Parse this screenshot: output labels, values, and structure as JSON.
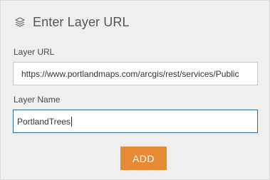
{
  "header": {
    "title": "Enter Layer URL",
    "icon": "layers-icon"
  },
  "layer_url": {
    "label": "Layer URL",
    "value": "https://www.portlandmaps.com/arcgis/rest/services/Public"
  },
  "layer_name": {
    "label": "Layer Name",
    "value": "PortlandTrees"
  },
  "actions": {
    "add_label": "ADD"
  },
  "colors": {
    "panel_bg": "#efefef",
    "button_bg": "#e68a35",
    "focus_border": "#2c6e9b"
  }
}
